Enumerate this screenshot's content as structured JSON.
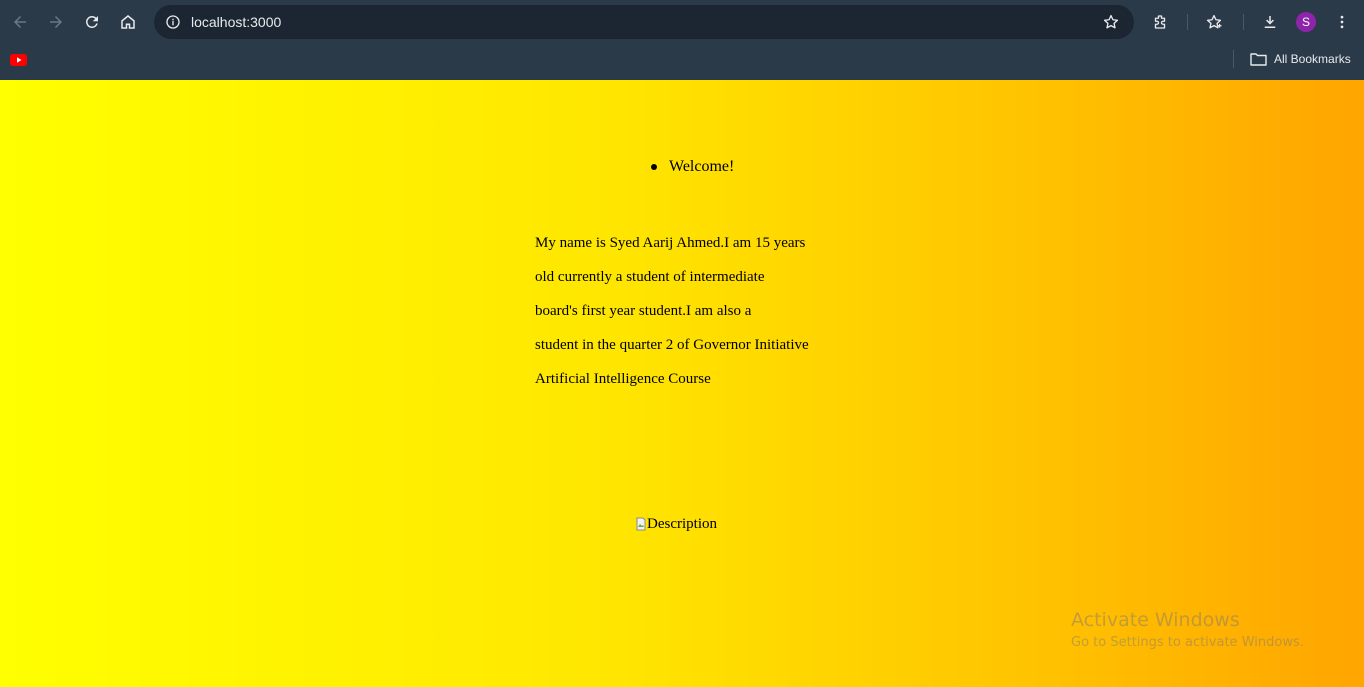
{
  "browser": {
    "url": "localhost:3000",
    "profile_initial": "S",
    "bookmarks_bar": {
      "items": [
        {
          "icon": "youtube-icon"
        }
      ],
      "all_bookmarks_label": "All Bookmarks"
    },
    "toolbar_icons": [
      "back-icon",
      "forward-icon",
      "reload-icon",
      "home-icon",
      "site-info-icon",
      "bookmark-star-icon",
      "extensions-icon",
      "favorites-icon",
      "download-icon",
      "menu-icon"
    ],
    "colors": {
      "chrome": "#2b3a48",
      "omnibox": "#1b2632",
      "avatar": "#8e24aa"
    }
  },
  "page": {
    "welcome": "Welcome!",
    "intro_lines": [
      "My name is Syed Aarij Ahmed.I am 15 years",
      "old currently a student of intermediate",
      "board's first year student.I am also a",
      "student in the quarter 2 of Governor Initiative",
      "Artificial Intelligence Course"
    ],
    "image_alt": "Description",
    "background_gradient": [
      "#ffff00",
      "#ffa500"
    ]
  },
  "watermark": {
    "title": "Activate Windows",
    "subtitle": "Go to Settings to activate Windows."
  }
}
